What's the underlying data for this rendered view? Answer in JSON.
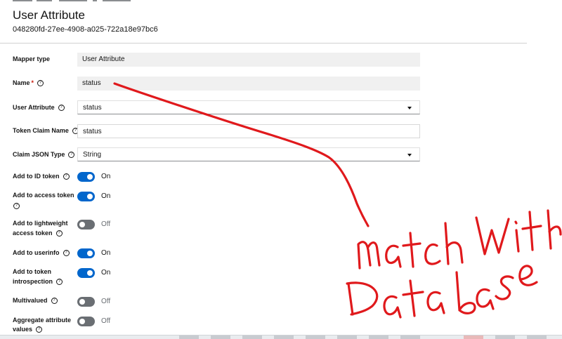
{
  "header": {
    "title": "User Attribute",
    "id": "048280fd-27ee-4908-a025-722a18e97bc6"
  },
  "form": {
    "mapper_type": {
      "label": "Mapper type",
      "value": "User Attribute"
    },
    "name": {
      "label": "Name",
      "required_mark": "*",
      "value": "status"
    },
    "user_attribute": {
      "label": "User Attribute",
      "value": "status"
    },
    "token_claim_name": {
      "label": "Token Claim Name",
      "value": "status"
    },
    "claim_json_type": {
      "label": "Claim JSON Type",
      "value": "String"
    },
    "toggles": [
      {
        "label_line1": "Add to ID token",
        "label_line2": "",
        "state": "On",
        "on": true
      },
      {
        "label_line1": "Add to access token",
        "label_line2": "",
        "state": "On",
        "on": true
      },
      {
        "label_line1": "Add to lightweight",
        "label_line2": "access token",
        "state": "Off",
        "on": false
      },
      {
        "label_line1": "Add to userinfo",
        "label_line2": "",
        "state": "On",
        "on": true
      },
      {
        "label_line1": "Add to token",
        "label_line2": "introspection",
        "state": "On",
        "on": true
      },
      {
        "label_line1": "Multivalued",
        "label_line2": "",
        "state": "Off",
        "on": false
      },
      {
        "label_line1": "Aggregate attribute",
        "label_line2": "values",
        "state": "Off",
        "on": false
      }
    ]
  },
  "annotation": {
    "line1": "match with",
    "line2": "Database",
    "color": "#e0191c"
  },
  "colors": {
    "toggle_on": "#0066cc",
    "toggle_off": "#6a6e73",
    "required": "#c9190b"
  },
  "icons": {
    "help": "question-circle-icon",
    "dropdown": "caret-down-icon"
  }
}
